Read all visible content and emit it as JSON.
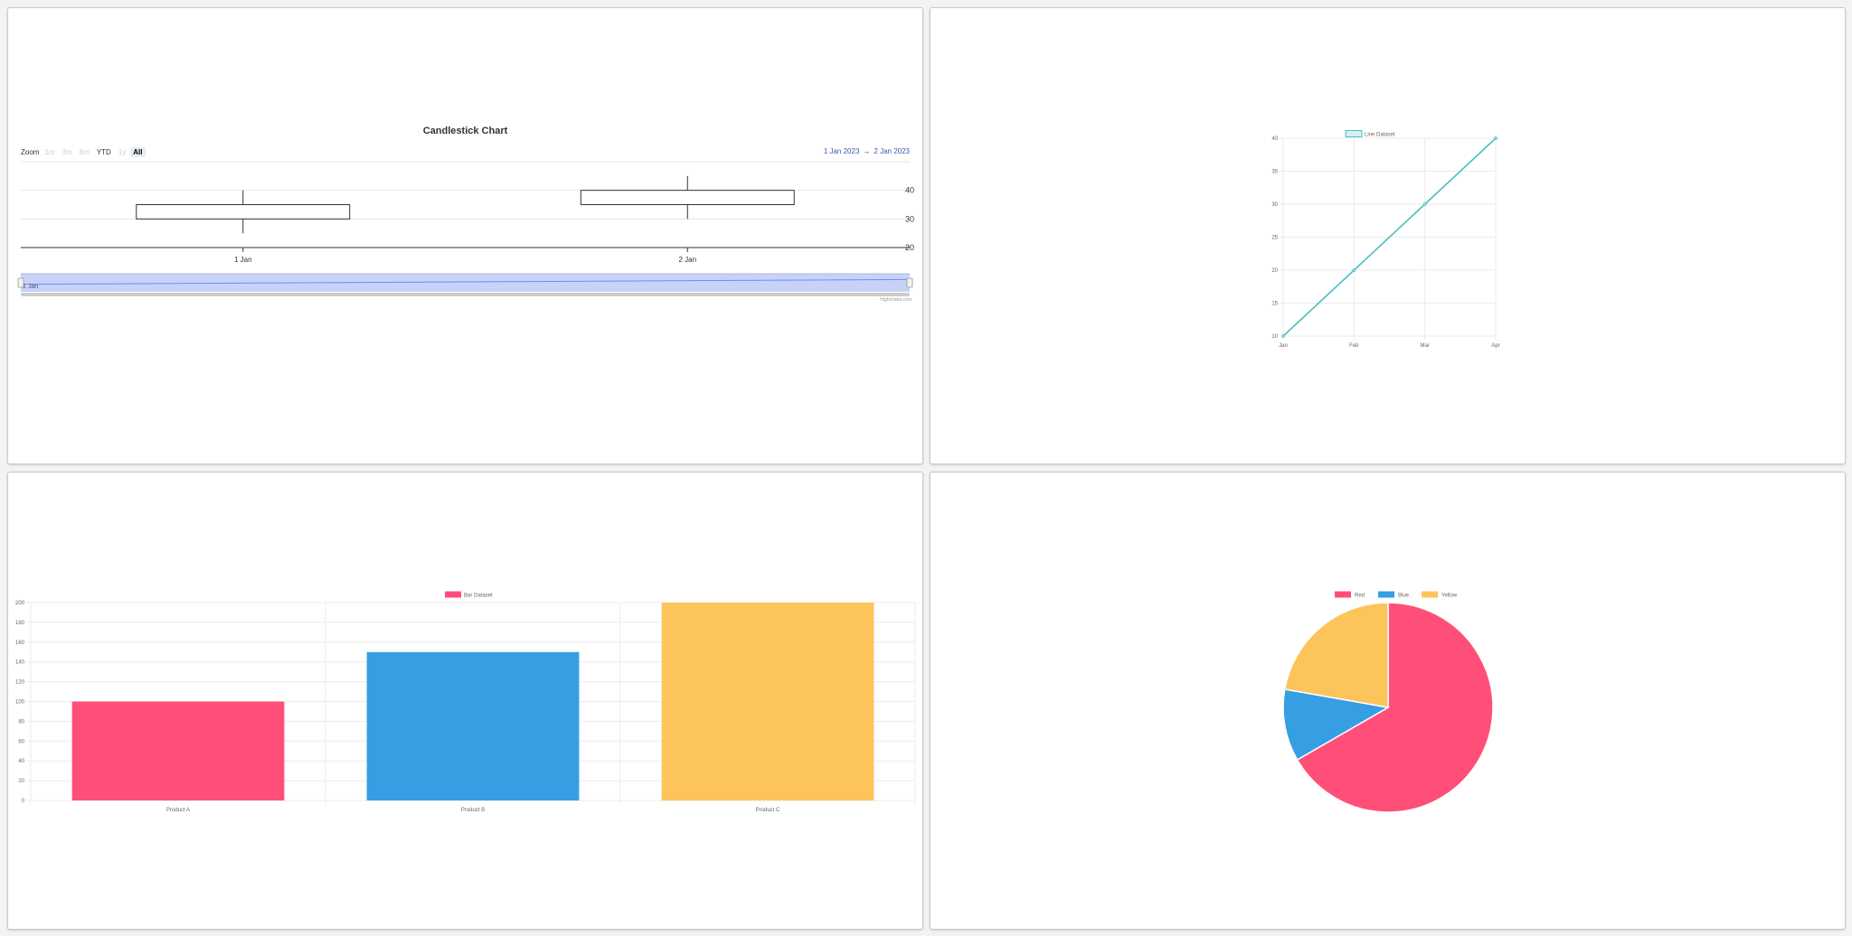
{
  "colors": {
    "red": "#ff4f79",
    "blue": "#369ee3",
    "yellow": "#fdc45c",
    "teal": "#4bc0c0",
    "navigator": "#c8d2f8",
    "link": "#335cad"
  },
  "candlestick": {
    "title": "Candlestick Chart",
    "zoom_label": "Zoom",
    "zoom_buttons": [
      {
        "label": "1m",
        "state": "disabled"
      },
      {
        "label": "3m",
        "state": "disabled"
      },
      {
        "label": "6m",
        "state": "disabled"
      },
      {
        "label": "YTD",
        "state": "enabled"
      },
      {
        "label": "1y",
        "state": "disabled"
      },
      {
        "label": "All",
        "state": "active"
      }
    ],
    "range_from": "1 Jan 2023",
    "range_arrow": "→",
    "range_to": "2 Jan 2023",
    "navigator_label": "1 Jan",
    "credits": "Highcharts.com"
  },
  "line_panel": {
    "legend": "Line Dataset"
  },
  "bar_panel": {
    "legend": "Bar Dataset"
  },
  "chart_data": [
    {
      "type": "candlestick",
      "title": "Candlestick Chart",
      "categories": [
        "1 Jan",
        "2 Jan"
      ],
      "ohlc": [
        {
          "x": "1 Jan",
          "open": 30,
          "high": 40,
          "low": 25,
          "close": 35
        },
        {
          "x": "2 Jan",
          "open": 35,
          "high": 45,
          "low": 30,
          "close": 40
        }
      ],
      "ylim": [
        20,
        50
      ],
      "yticks": [
        20,
        30,
        40
      ],
      "grid": true,
      "legend": "none"
    },
    {
      "type": "line",
      "categories": [
        "Jan",
        "Feb",
        "Mar",
        "Apr"
      ],
      "series": [
        {
          "name": "Line Dataset",
          "values": [
            10,
            20,
            30,
            40
          ]
        }
      ],
      "ylim": [
        10,
        40
      ],
      "yticks": [
        10,
        15,
        20,
        25,
        30,
        35,
        40
      ],
      "grid": true,
      "legend": "top"
    },
    {
      "type": "bar",
      "categories": [
        "Product A",
        "Product B",
        "Product C"
      ],
      "series": [
        {
          "name": "Bar Dataset",
          "values": [
            100,
            150,
            200
          ]
        }
      ],
      "ylim": [
        0,
        200
      ],
      "yticks": [
        0,
        20,
        40,
        60,
        80,
        100,
        120,
        140,
        160,
        180,
        200
      ],
      "grid": true,
      "legend": "top"
    },
    {
      "type": "pie",
      "labels": [
        "Red",
        "Blue",
        "Yellow"
      ],
      "values": [
        300,
        50,
        100
      ],
      "legend": "top"
    }
  ]
}
